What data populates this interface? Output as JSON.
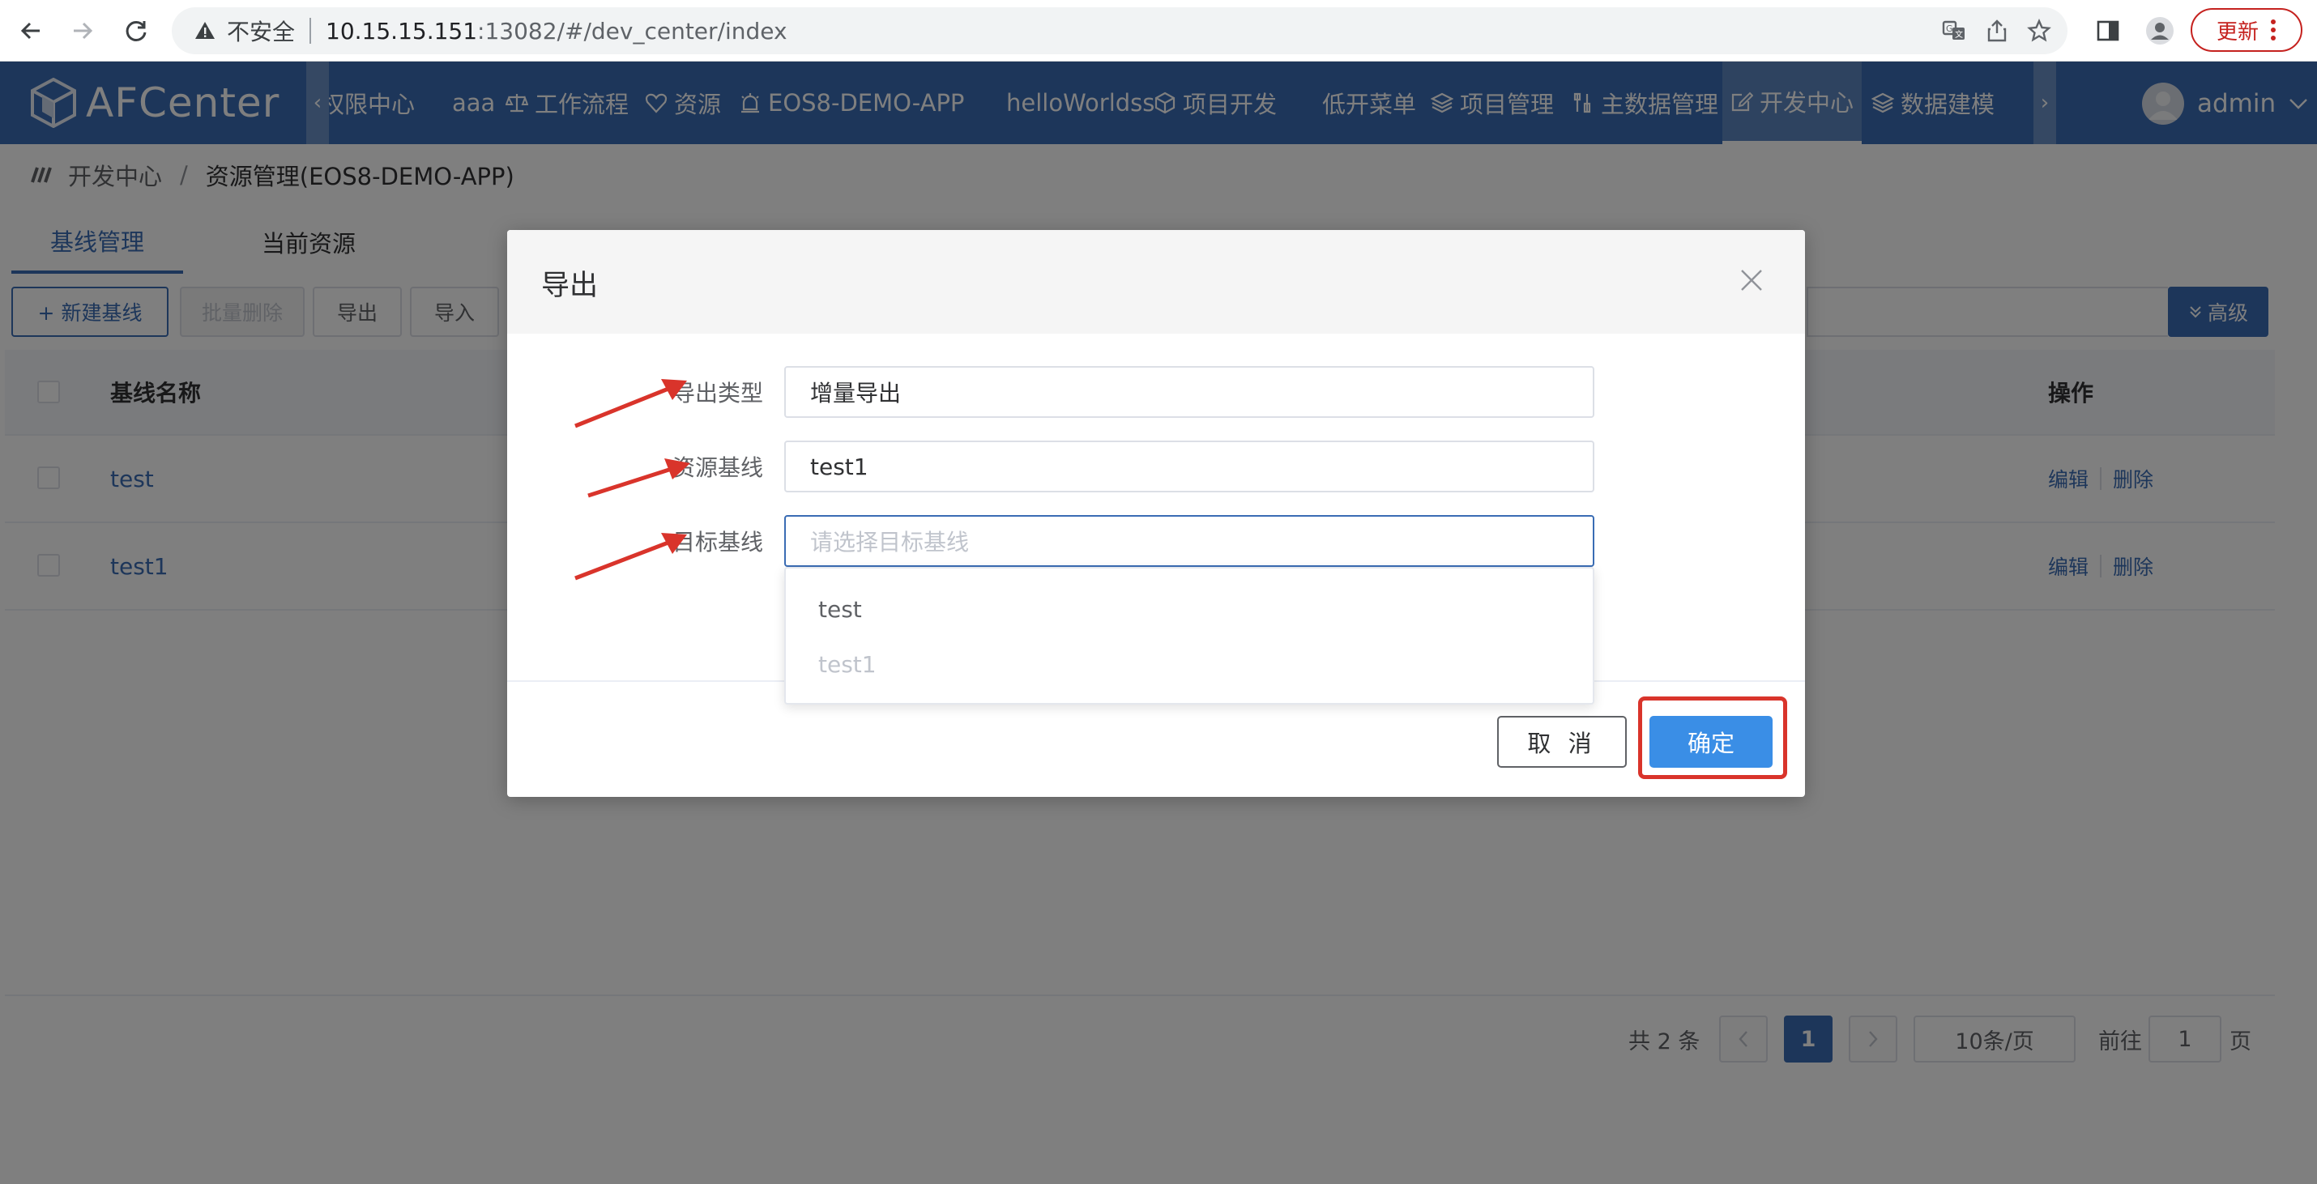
{
  "browser": {
    "insecure_label": "不安全",
    "url_host": "10.15.15.151",
    "url_path": ":13082/#/dev_center/index",
    "update_label": "更新"
  },
  "app": {
    "logo_text": "AFCenter",
    "menu": [
      {
        "label": "权限中心"
      },
      {
        "label": "aaa"
      },
      {
        "label": "工作流程"
      },
      {
        "label": "资源"
      },
      {
        "label": "EOS8-DEMO-APP"
      },
      {
        "label": "helloWorldss"
      },
      {
        "label": "项目开发"
      },
      {
        "label": "低开菜单"
      },
      {
        "label": "项目管理"
      },
      {
        "label": "主数据管理"
      },
      {
        "label": "开发中心"
      },
      {
        "label": "数据建模"
      }
    ],
    "user_name": "admin"
  },
  "page": {
    "breadcrumb": [
      "开发中心",
      "资源管理(EOS8-DEMO-APP)"
    ],
    "breadcrumb_sep": "/",
    "tabs": [
      "基线管理",
      "当前资源"
    ],
    "toolbar": {
      "new_label": "+ 新建基线",
      "batch_delete_label": "批量删除",
      "export_label": "导出",
      "import_label": "导入",
      "advanced_label": "高级"
    },
    "table": {
      "col_name": "基线名称",
      "col_ops": "操作",
      "rows": [
        {
          "name": "test",
          "edit": "编辑",
          "delete": "删除"
        },
        {
          "name": "test1",
          "edit": "编辑",
          "delete": "删除"
        }
      ]
    },
    "pagination": {
      "total": "共 2 条",
      "current_page": "1",
      "page_size": "10条/页",
      "goto_label": "前往",
      "goto_value": "1",
      "page_suffix": "页"
    }
  },
  "dialog": {
    "title": "导出",
    "fields": [
      {
        "label": "导出类型",
        "value": "增量导出"
      },
      {
        "label": "资源基线",
        "value": "test1"
      },
      {
        "label": "目标基线",
        "placeholder": "请选择目标基线"
      }
    ],
    "dropdown_options": [
      "test",
      "test1"
    ],
    "cancel_label": "取 消",
    "confirm_label": "确定"
  },
  "colors": {
    "brand": "#3a6cb4",
    "confirm": "#3a8ee6",
    "annotation": "#d9342b"
  }
}
